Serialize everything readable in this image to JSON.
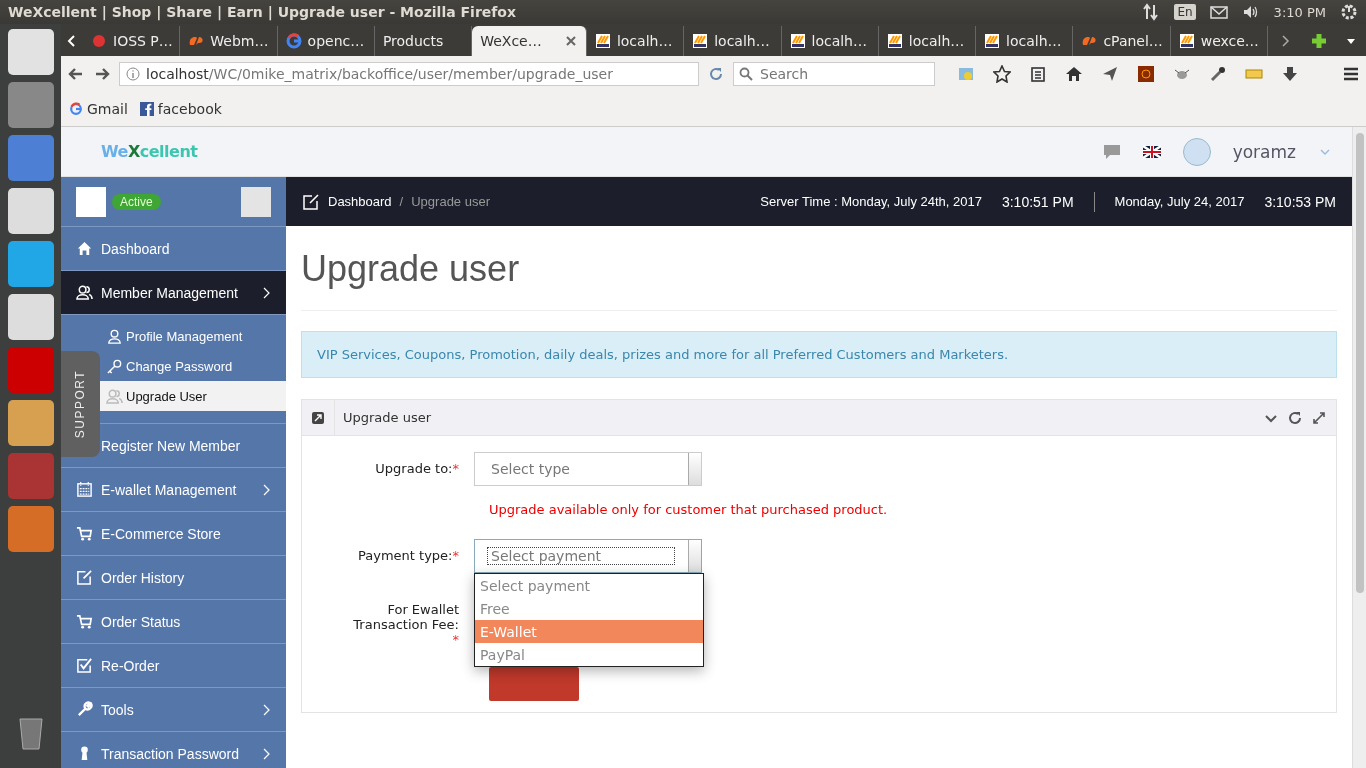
{
  "os_bar": {
    "title": "WeXcellent | Shop | Share | Earn | Upgrade user - Mozilla Firefox",
    "language": "En",
    "time": "3:10 PM"
  },
  "browser": {
    "tabs": [
      {
        "label": "IOSS P…",
        "kind": "red",
        "selected": false
      },
      {
        "label": "Webm…",
        "kind": "cpanel",
        "selected": false
      },
      {
        "label": "openc…",
        "kind": "google",
        "selected": false
      },
      {
        "label": "Products",
        "kind": "none",
        "selected": false
      },
      {
        "label": "WeXce…",
        "kind": "none",
        "selected": true
      },
      {
        "label": "localh…",
        "kind": "pma",
        "selected": false
      },
      {
        "label": "localh…",
        "kind": "pma",
        "selected": false
      },
      {
        "label": "localh…",
        "kind": "pma",
        "selected": false
      },
      {
        "label": "localh…",
        "kind": "pma",
        "selected": false
      },
      {
        "label": "localh…",
        "kind": "pma",
        "selected": false
      },
      {
        "label": "cPanel…",
        "kind": "cpanel",
        "selected": false
      },
      {
        "label": "wexce…",
        "kind": "pma",
        "selected": false
      }
    ],
    "address": {
      "host": "localhost",
      "path": "/WC/0mike_matrix/backoffice/user/member/upgrade_user"
    },
    "search": {
      "placeholder": "Search"
    },
    "bookmarks": [
      {
        "label": "Gmail",
        "kind": "google"
      },
      {
        "label": "facebook",
        "kind": "facebook"
      }
    ]
  },
  "site": {
    "logo": {
      "start": "We",
      "mark": "X",
      "end": "cellent"
    },
    "user": "yoramz",
    "status": "Active",
    "support": "SUPPORT"
  },
  "sidebar": {
    "items": [
      {
        "label": "Dashboard",
        "expandable": false,
        "selected": false
      },
      {
        "label": "Member Management",
        "expandable": true,
        "selected": true,
        "children": [
          {
            "label": "Profile Management",
            "selected": false
          },
          {
            "label": "Change Password",
            "selected": false
          },
          {
            "label": "Upgrade User",
            "selected": true
          }
        ]
      },
      {
        "label": "Register New Member",
        "expandable": false,
        "selected": false
      },
      {
        "label": "E-wallet Management",
        "expandable": true,
        "selected": false
      },
      {
        "label": "E-Commerce Store",
        "expandable": false,
        "selected": false
      },
      {
        "label": "Order History",
        "expandable": false,
        "selected": false
      },
      {
        "label": "Order Status",
        "expandable": false,
        "selected": false
      },
      {
        "label": "Re-Order",
        "expandable": false,
        "selected": false
      },
      {
        "label": "Tools",
        "expandable": true,
        "selected": false
      },
      {
        "label": "Transaction Password",
        "expandable": true,
        "selected": false
      }
    ]
  },
  "breadcrumb": {
    "items": [
      "Dashboard",
      "Upgrade user"
    ],
    "separator": "/"
  },
  "clock": {
    "server_label": "Server Time : Monday, July 24th, 2017",
    "server_time": "3:10:51 PM",
    "local_date": "Monday, July 24, 2017",
    "local_time": "3:10:53 PM"
  },
  "page_title": "Upgrade user",
  "alert": "VIP Services, Coupons, Promotion, daily deals, prizes and more for all Preferred Customers and Marketers.",
  "panel": {
    "title": "Upgrade user",
    "upgrade_to": {
      "label": "Upgrade to:",
      "required_mark": "*",
      "placeholder": "Select type"
    },
    "note": "Upgrade available only for customer that purchased product.",
    "payment_type": {
      "label": "Payment type:",
      "required_mark": "*",
      "value": "Select payment",
      "expanded": true,
      "options": [
        {
          "label": "Select payment",
          "highlighted": false
        },
        {
          "label": "Free",
          "highlighted": false
        },
        {
          "label": "E-Wallet",
          "highlighted": true
        },
        {
          "label": "PayPal",
          "highlighted": false
        }
      ]
    },
    "fee": {
      "label": "For Ewallet Transaction Fee:",
      "required_mark": "*"
    }
  }
}
